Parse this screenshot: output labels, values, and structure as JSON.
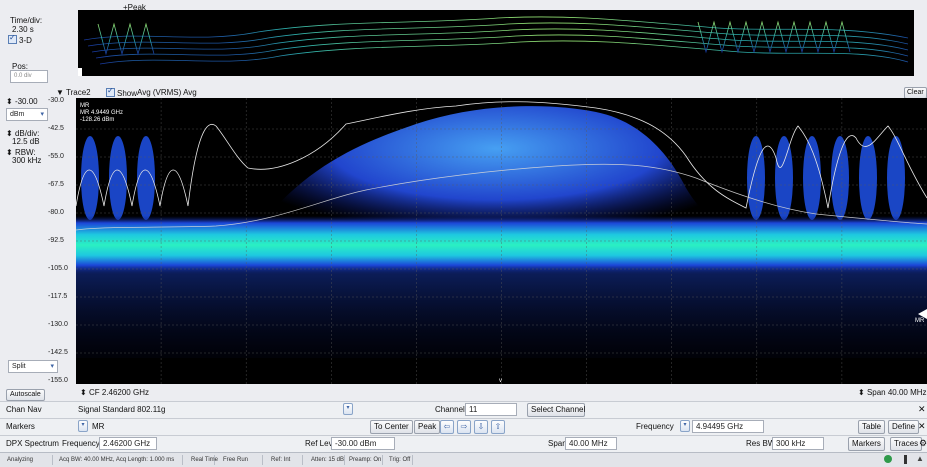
{
  "top_panel": {
    "peak_label": "+Peak",
    "time_div_label": "Time/div:",
    "time_div_value": "2.30 s",
    "three_d_label": "3-D",
    "pos_label": "Pos:",
    "pos_value": "0.0 div"
  },
  "trace_header": {
    "trace_select": "Trace2",
    "show_label": "Show",
    "detection": "Avg (VRMS) Avg",
    "clear_button": "Clear"
  },
  "left_panel": {
    "ref_value": "-30.00",
    "unit_select": "dBm",
    "db_div_label": "dB/div:",
    "db_div_value": "12.5 dB",
    "rbw_label": "RBW:",
    "rbw_value": "300 kHz",
    "split_select": "Split",
    "autoscale_button": "Autoscale"
  },
  "marker_readout": {
    "name": "MR",
    "freq": "MR 4.9449 GHz",
    "level": "-128.26 dBm"
  },
  "y_axis_ticks": [
    "-30.0",
    "-42.5",
    "-55.0",
    "-67.5",
    "-80.0",
    "-92.5",
    "-105.0",
    "-117.5",
    "-130.0",
    "-142.5",
    "-155.0"
  ],
  "bottom_axis": {
    "cf": "CF 2.46200 GHz",
    "span": "Span 40.00 MHz",
    "mr_flag": "MR"
  },
  "chan_nav": {
    "label": "Chan Nav",
    "signal_standard": "Signal Standard  802.11g",
    "channel_label": "Channel",
    "channel_value": "11",
    "select_button": "Select Channel"
  },
  "markers_row": {
    "label": "Markers",
    "marker_select": "MR",
    "to_center": "To Center",
    "peak": "Peak",
    "frequency_label": "Frequency",
    "frequency_value": "4.94495 GHz",
    "table_button": "Table",
    "define_button": "Define"
  },
  "dpx_row": {
    "label": "DPX Spectrum",
    "frequency_label": "Frequency",
    "frequency_value": "2.46200 GHz",
    "ref_lev_label": "Ref Lev",
    "ref_lev_value": "-30.00 dBm",
    "span_label": "Span",
    "span_value": "40.00 MHz",
    "res_bw_label": "Res BW",
    "res_bw_value": "300 kHz",
    "markers_button": "Markers",
    "traces_button": "Traces"
  },
  "status_bar": {
    "state": "Analyzing",
    "acq": "Acq BW: 40.00 MHz, Acq Length: 1.000 ms",
    "real_time": "Real Time",
    "free_run": "Free Run",
    "ref": "Ref: Int",
    "atten": "Atten: 15 dB",
    "preamp": "Preamp: On",
    "trig": "Trig: Off"
  },
  "colors": {
    "plot_bg": "#000000",
    "spectrum_core": "#1ee3c6",
    "spectrum_blue": "#2a63ff",
    "trace_line": "#e8e8e8",
    "accent": "#3f65a6"
  }
}
